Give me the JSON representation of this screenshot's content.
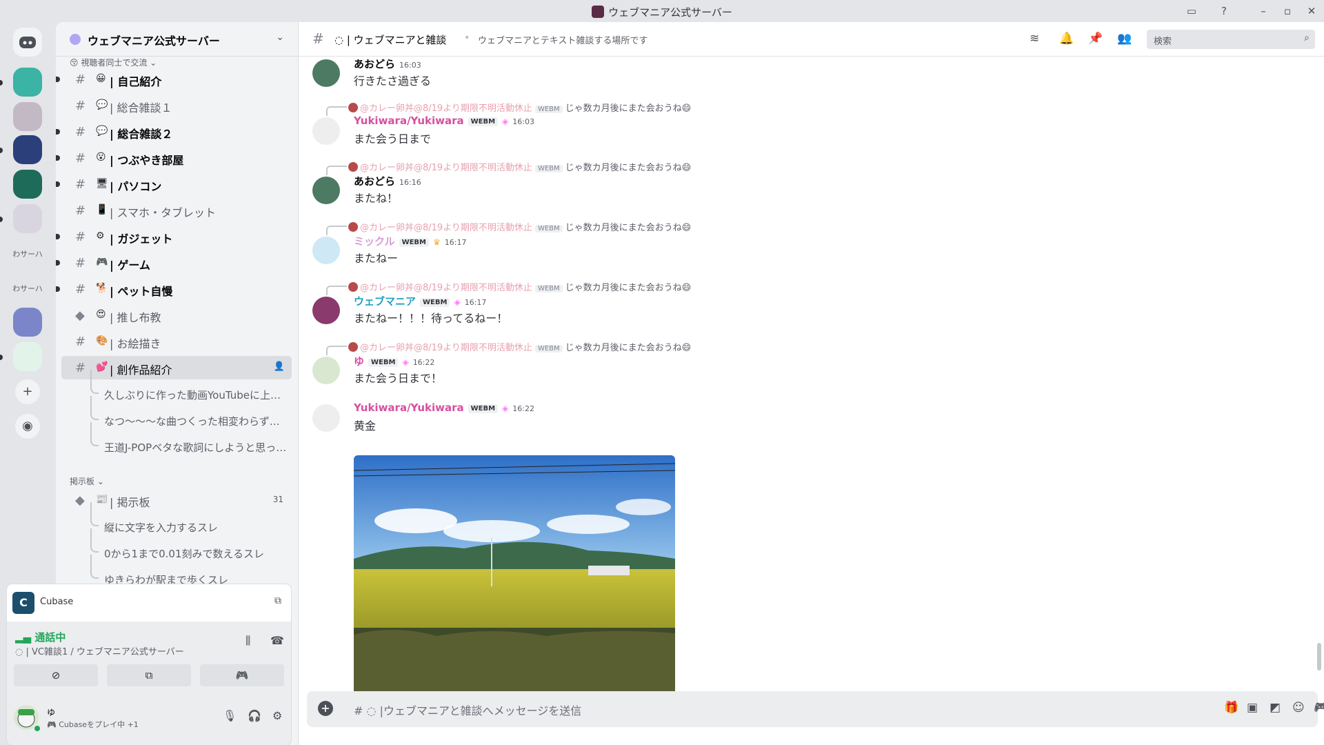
{
  "titlebar": {
    "title": "ウェブマニア公式サーバー"
  },
  "rail": {
    "server_text_1": "わサーハ",
    "server_text_2": "わサーハ"
  },
  "server": {
    "name": "ウェブマニア公式サーバー"
  },
  "sidebar": {
    "category_top": "😚 視聴者同士で交流 ⌄",
    "channels": [
      {
        "emoji": "😀",
        "label": "| 自己紹介"
      },
      {
        "emoji": "💬",
        "label": "| 総合雑談１"
      },
      {
        "emoji": "💬",
        "label": "| 総合雑談２"
      },
      {
        "emoji": "😮",
        "label": "| つぶやき部屋"
      },
      {
        "emoji": "🖥",
        "label": "| パソコン"
      },
      {
        "emoji": "📱",
        "label": "| スマホ・タブレット"
      },
      {
        "emoji": "⚙",
        "label": "| ガジェット"
      },
      {
        "emoji": "🎮",
        "label": "| ゲーム"
      },
      {
        "emoji": "🐕",
        "label": "| ペット自慢"
      },
      {
        "emoji": "😍",
        "label": "| 推し布教"
      },
      {
        "emoji": "🎨",
        "label": "| お絵描き"
      },
      {
        "emoji": "💕",
        "label": "| 創作品紹介"
      }
    ],
    "threads_a": [
      "久しぶりに作った動画YouTubeに上げ…",
      "なつ～～～な曲つくった相変わらず…",
      "王道J-POPベタな歌詞にしようと思っ…"
    ],
    "category_board": "掲示板 ⌄",
    "board_channel": {
      "emoji": "📰",
      "label": "| 掲示板",
      "count": "31"
    },
    "threads_b": [
      "縦に文字を入力するスレ",
      "0から1まで0.01刻みで数えるスレ",
      "ゆきらわが駅まで歩くスレ"
    ]
  },
  "activity": {
    "game": "Cubase",
    "voice_status": "通話中",
    "voice_channel": "| VC雑談1 / ウェブマニア公式サーバー",
    "user": {
      "name": "ゆ",
      "status": "Cubaseをプレイ中 +1"
    }
  },
  "header": {
    "channel": "| ウェブマニアと雑談",
    "topic": "ウェブマニアとテキスト雑談する場所です",
    "search_placeholder": "検索"
  },
  "reply_preview": {
    "name": "@カレー卵丼@8/19より期限不明活動休止",
    "tag": "WEBM",
    "text": "じゃ数カ月後にまた会おうね😄"
  },
  "messages": [
    {
      "name": "あおどら",
      "time": "16:03",
      "text": "行きたさ過ぎる"
    },
    {
      "name": "Yukiwara/Yukiwara",
      "tag": "WEBM",
      "time": "16:03",
      "text": "また会う日まで"
    },
    {
      "name": "あおどら",
      "time": "16:16",
      "text": "またね！"
    },
    {
      "name": "ミックル",
      "tag": "WEBM",
      "time": "16:17",
      "text": "またねー"
    },
    {
      "name": "ウェブマニア",
      "tag": "WEBM",
      "time": "16:17",
      "text": "またねー！！！待ってるねー！"
    },
    {
      "name": "ゆ",
      "tag": "WEBM",
      "time": "16:22",
      "text": "また会う日まで！"
    },
    {
      "name": "Yukiwara/Yukiwara",
      "tag": "WEBM",
      "time": "16:22",
      "text": "黄金"
    }
  ],
  "composer": {
    "placeholder": "|ウェブマニアと雑談へメッセージを送信"
  },
  "colors": {
    "accent": "#5865f2",
    "online": "#23a55a",
    "boost": "#ff73fa"
  }
}
